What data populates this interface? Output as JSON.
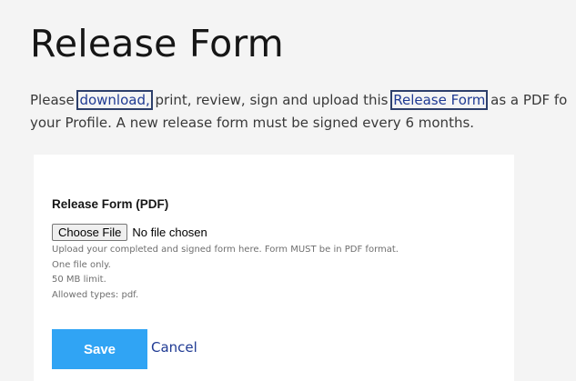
{
  "page": {
    "title": "Release Form",
    "intro": {
      "line1_before": "Please ",
      "download_link": "download,",
      "line1_middle": " print, review, sign and upload this ",
      "release_form_link": "Release Form",
      "line1_after": " as a PDF fo",
      "line2": "your Profile.  A new release form must be signed every 6 months."
    }
  },
  "form": {
    "field_label": "Release Form (PDF)",
    "file_input": {
      "button_label": "Choose File",
      "status": "No file chosen"
    },
    "help_text": [
      "Upload your completed and signed form here. Form MUST be in PDF format.",
      "One file only.",
      "50 MB limit.",
      "Allowed types: pdf."
    ],
    "save_label": "Save",
    "cancel_label": "Cancel"
  },
  "colors": {
    "background": "#f4f4f4",
    "card": "#ffffff",
    "link": "#1f3a93",
    "link_outline": "#2d3f6b",
    "save_button": "#30a4f4",
    "help_text": "#6f6f6f"
  }
}
